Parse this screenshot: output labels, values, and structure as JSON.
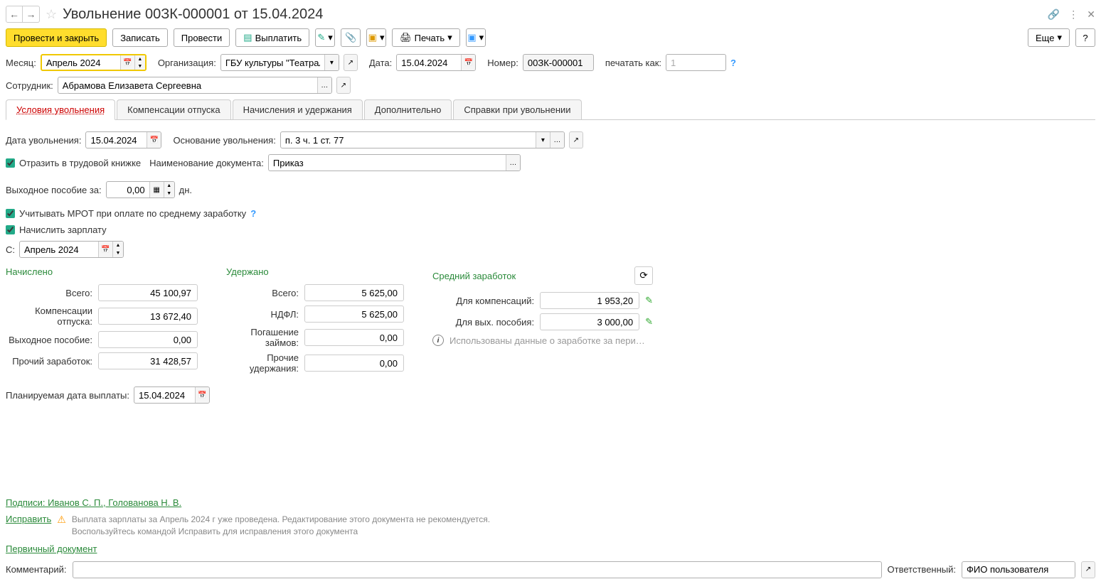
{
  "header": {
    "title": "Увольнение 00ЗК-000001 от 15.04.2024"
  },
  "toolbar": {
    "post_and_close": "Провести и закрыть",
    "save": "Записать",
    "post": "Провести",
    "pay": "Выплатить",
    "print": "Печать",
    "more": "Еще",
    "help": "?"
  },
  "header_fields": {
    "month_label": "Месяц:",
    "month_value": "Апрель 2024",
    "org_label": "Организация:",
    "org_value": "ГБУ культуры \"Театральнь",
    "date_label": "Дата:",
    "date_value": "15.04.2024",
    "number_label": "Номер:",
    "number_value": "00ЗК-000001",
    "print_as_label": "печатать как:",
    "print_as_value": "1",
    "employee_label": "Сотрудник:",
    "employee_value": "Абрамова Елизавета Сергеевна"
  },
  "tabs": [
    {
      "label": "Условия увольнения"
    },
    {
      "label": "Компенсации отпуска"
    },
    {
      "label": "Начисления и удержания"
    },
    {
      "label": "Дополнительно"
    },
    {
      "label": "Справки при увольнении"
    }
  ],
  "dismissal": {
    "date_label": "Дата увольнения:",
    "date_value": "15.04.2024",
    "reason_label": "Основание увольнения:",
    "reason_value": "п. 3 ч. 1 ст. 77",
    "workbook_label": "Отразить в трудовой книжке",
    "docname_label": "Наименование документа:",
    "docname_value": "Приказ",
    "severance_label": "Выходное пособие за:",
    "severance_value": "0,00",
    "severance_unit": "дн.",
    "mrot_label": "Учитывать МРОТ при оплате по среднему заработку",
    "accrue_label": "Начислить зарплату",
    "from_label": "С:",
    "from_value": "Апрель 2024"
  },
  "summary": {
    "accrued": {
      "header": "Начислено",
      "total_label": "Всего:",
      "total_value": "45 100,97",
      "vacation_label": "Компенсации отпуска:",
      "vacation_value": "13 672,40",
      "severance_label": "Выходное пособие:",
      "severance_value": "0,00",
      "other_label": "Прочий заработок:",
      "other_value": "31 428,57"
    },
    "withheld": {
      "header": "Удержано",
      "total_label": "Всего:",
      "total_value": "5 625,00",
      "ndfl_label": "НДФЛ:",
      "ndfl_value": "5 625,00",
      "loan_label": "Погашение займов:",
      "loan_value": "0,00",
      "other_label": "Прочие удержания:",
      "other_value": "0,00"
    },
    "average": {
      "header": "Средний заработок",
      "comp_label": "Для компенсаций:",
      "comp_value": "1 953,20",
      "severance_label": "Для вых. пособия:",
      "severance_value": "3 000,00",
      "info_text": "Использованы данные о заработке за пери…"
    }
  },
  "planned_payment": {
    "label": "Планируемая дата выплаты:",
    "value": "15.04.2024"
  },
  "footer": {
    "signatures": "Подписи: Иванов С. П., Голованова Н. В.",
    "fix_link": "Исправить",
    "warning": "Выплата зарплаты за Апрель 2024 г уже проведена. Редактирование этого документа не рекомендуется.\nВоспользуйтесь командой Исправить для исправления этого документа",
    "primary_doc": "Первичный документ",
    "comment_label": "Комментарий:",
    "responsible_label": "Ответственный:",
    "responsible_value": "ФИО пользователя"
  }
}
